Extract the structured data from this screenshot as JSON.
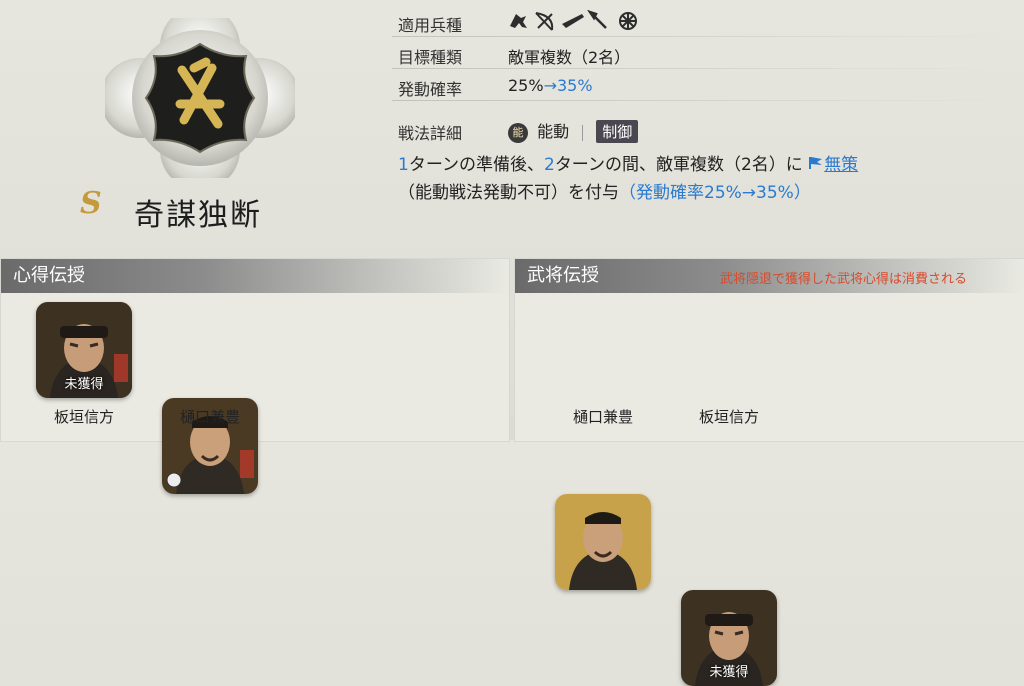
{
  "skill": {
    "grade": "S",
    "name": "奇謀独断",
    "labels": {
      "troop": "適用兵種",
      "target": "目標種類",
      "rate": "発動確率",
      "detail": "戦法詳細"
    },
    "target_value": "敵軍複数（2名）",
    "rate_base": "25%",
    "rate_arrow": "→35%",
    "type_badge": "能",
    "type_label": "能動",
    "category": "制御",
    "troop_icons": [
      "cavalry-icon",
      "bow-icon",
      "gun-icon",
      "spear-icon",
      "wheel-icon"
    ],
    "desc": {
      "n1": "1",
      "t1": "ターンの準備後、",
      "n2": "2",
      "t2": "ターンの間、敵軍複数（2名）に",
      "status": "無策",
      "t3": "（能動戦法発動不可）を付与",
      "t4": "（発動確率25%→35%）"
    }
  },
  "inherit_panel": {
    "title": "心得伝授",
    "cards": [
      {
        "name": "板垣信方",
        "status": "未獲得"
      },
      {
        "name": "樋口兼豊",
        "status": ""
      }
    ]
  },
  "general_panel": {
    "title": "武将伝授",
    "note": "武将隠退で獲得した武将心得は消費される",
    "cards": [
      {
        "name": "樋口兼豊",
        "status": ""
      },
      {
        "name": "板垣信方",
        "status": "未獲得"
      }
    ]
  },
  "colors": {
    "accent_blue": "#2a7ad0",
    "note_red": "#d94a2a",
    "gold": "#c59a3c"
  }
}
